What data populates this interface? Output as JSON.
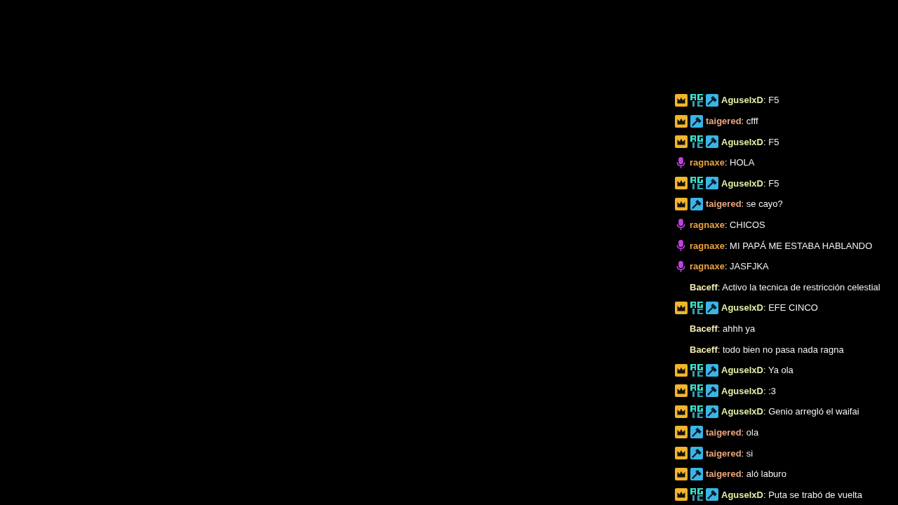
{
  "chat": {
    "messages": [
      {
        "badges": [
          {
            "kind": "crown"
          },
          {
            "kind": "pixel"
          },
          {
            "kind": "hammer"
          }
        ],
        "user": "AguselxD",
        "color": "#e4eea6",
        "text": ": F5"
      },
      {
        "badges": [
          {
            "kind": "crown"
          },
          {
            "kind": "hammer"
          }
        ],
        "user": "taigered",
        "color": "#eda57c",
        "text": ": cfff"
      },
      {
        "badges": [
          {
            "kind": "crown"
          },
          {
            "kind": "pixel"
          },
          {
            "kind": "hammer"
          }
        ],
        "user": "AguselxD",
        "color": "#e4eea6",
        "text": ": F5"
      },
      {
        "badges": [
          {
            "kind": "mic"
          }
        ],
        "user": "ragnaxe",
        "color": "#eda33c",
        "text": ": HOLA"
      },
      {
        "badges": [
          {
            "kind": "crown"
          },
          {
            "kind": "pixel"
          },
          {
            "kind": "hammer"
          }
        ],
        "user": "AguselxD",
        "color": "#e4eea6",
        "text": ": F5"
      },
      {
        "badges": [
          {
            "kind": "crown"
          },
          {
            "kind": "hammer"
          }
        ],
        "user": "taigered",
        "color": "#eda57c",
        "text": ": se cayo?"
      },
      {
        "badges": [
          {
            "kind": "mic"
          }
        ],
        "user": "ragnaxe",
        "color": "#eda33c",
        "text": ": CHICOS"
      },
      {
        "badges": [
          {
            "kind": "mic"
          }
        ],
        "user": "ragnaxe",
        "color": "#eda33c",
        "text": ": MI PAPÁ ME ESTABA HABLANDO"
      },
      {
        "badges": [
          {
            "kind": "mic"
          }
        ],
        "user": "ragnaxe",
        "color": "#eda33c",
        "text": ": JASFJKA"
      },
      {
        "user": "Baceff",
        "color": "#f1edb0",
        "text": ": Activo la tecnica de restricción celestial"
      },
      {
        "badges": [
          {
            "kind": "crown"
          },
          {
            "kind": "pixel"
          },
          {
            "kind": "hammer"
          }
        ],
        "user": "AguselxD",
        "color": "#e4eea6",
        "text": ": EFE CINCO"
      },
      {
        "user": "Baceff",
        "color": "#f1edb0",
        "text": ": ahhh ya"
      },
      {
        "user": "Baceff",
        "color": "#f1edb0",
        "text": ": todo bien no pasa nada ragna"
      },
      {
        "badges": [
          {
            "kind": "crown"
          },
          {
            "kind": "pixel"
          },
          {
            "kind": "hammer"
          }
        ],
        "user": "AguselxD",
        "color": "#e4eea6",
        "text": ": Ya ola"
      },
      {
        "badges": [
          {
            "kind": "crown"
          },
          {
            "kind": "pixel"
          },
          {
            "kind": "hammer"
          }
        ],
        "user": "AguselxD",
        "color": "#e4eea6",
        "text": ": :3"
      },
      {
        "badges": [
          {
            "kind": "crown"
          },
          {
            "kind": "pixel"
          },
          {
            "kind": "hammer"
          }
        ],
        "user": "AguselxD",
        "color": "#e4eea6",
        "text": ": Genio arregló el waifai"
      },
      {
        "badges": [
          {
            "kind": "crown"
          },
          {
            "kind": "hammer"
          }
        ],
        "user": "taigered",
        "color": "#eda57c",
        "text": ": ola"
      },
      {
        "badges": [
          {
            "kind": "crown"
          },
          {
            "kind": "hammer"
          }
        ],
        "user": "taigered",
        "color": "#eda57c",
        "text": ": si"
      },
      {
        "badges": [
          {
            "kind": "crown"
          },
          {
            "kind": "hammer"
          }
        ],
        "user": "taigered",
        "color": "#eda57c",
        "text": ": aló laburo"
      },
      {
        "badges": [
          {
            "kind": "crown"
          },
          {
            "kind": "pixel"
          },
          {
            "kind": "hammer"
          }
        ],
        "user": "AguselxD",
        "color": "#e4eea6",
        "text": ": Puta se trabó de vuelta"
      }
    ]
  }
}
